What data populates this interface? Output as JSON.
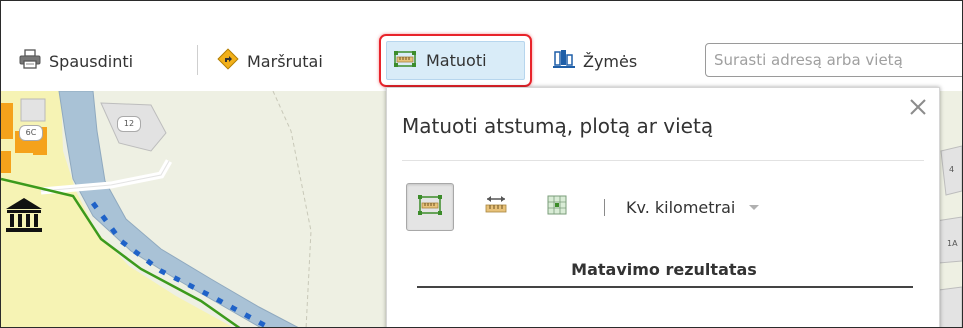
{
  "toolbar": {
    "print_label": "Spausdinti",
    "routes_label": "Maršrutai",
    "measure_label": "Matuoti",
    "bookmarks_label": "Žymės",
    "search_placeholder": "Surasti adresą arba vietą",
    "icons": {
      "print": "printer-icon",
      "routes": "directions-icon",
      "measure": "ruler-icon",
      "bookmarks": "bookmarks-icon"
    }
  },
  "map": {
    "labels": [
      "6C",
      "12",
      "4",
      "1A"
    ]
  },
  "measure_panel": {
    "title": "Matuoti atstumą, plotą ar vietą",
    "tools": [
      {
        "name": "area",
        "active": true
      },
      {
        "name": "distance",
        "active": false
      },
      {
        "name": "location",
        "active": false
      }
    ],
    "unit": "Kv. kilometrai",
    "result_label": "Matavimo rezultatas"
  },
  "colors": {
    "highlight_border": "#e8232a",
    "active_bg": "#d9ecf8",
    "river": "#a9c2d6",
    "park": "#f6f3b4",
    "boundary": "#3c9a1c",
    "path_dots": "#1f62c8",
    "buildings": "#f5a21b"
  }
}
